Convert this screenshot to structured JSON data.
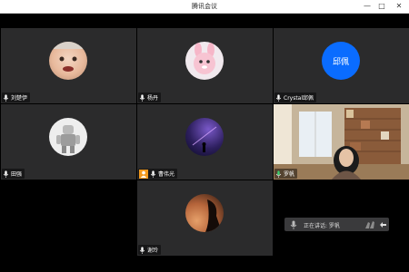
{
  "window": {
    "title": "腾讯会议"
  },
  "participants": [
    {
      "name": "刘楚伊"
    },
    {
      "name": "杨丹"
    },
    {
      "name": "Crystal邱佩",
      "avatar_text": "邱佩",
      "avatar_color": "#0a6cff"
    },
    {
      "name": "田强"
    },
    {
      "name": "曹伟光"
    },
    {
      "name": "罗帆"
    },
    {
      "name": "谢玲"
    }
  ],
  "speaking_bar": {
    "text": "正在讲话: 罗帆"
  },
  "colors": {
    "tile_bg": "#2b2b2c",
    "accent_blue": "#0a6cff",
    "host_badge": "#f39a1e"
  }
}
